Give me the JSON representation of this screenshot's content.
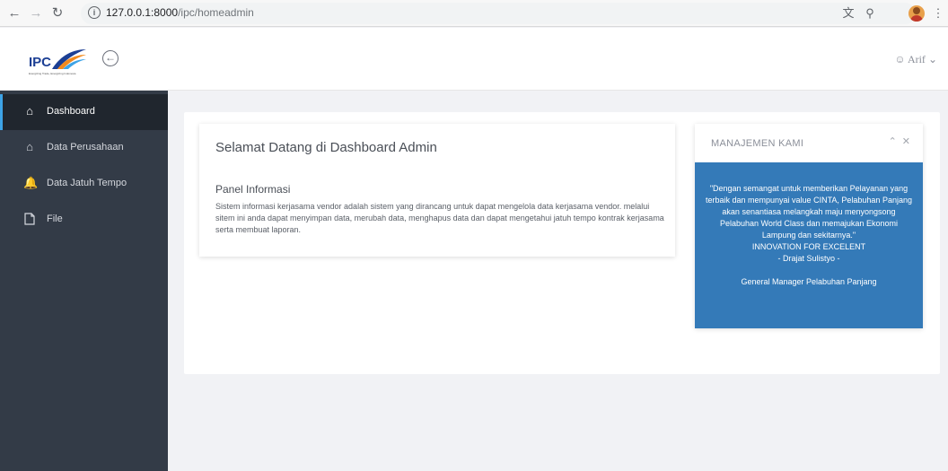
{
  "browser": {
    "back_icon": "arrow-left-icon",
    "forward_icon": "arrow-right-icon",
    "reload_icon": "reload-icon",
    "url_host": "127.0.0.1:8000",
    "url_path": "/ipc/homeadmin"
  },
  "header": {
    "logo_text": "IPC",
    "logo_tagline": "Energizing Trade, Energizing Indonesia",
    "user_name": "Arif"
  },
  "sidebar": {
    "items": [
      {
        "label": "Dashboard",
        "icon": "home-icon",
        "active": true
      },
      {
        "label": "Data Perusahaan",
        "icon": "home-icon",
        "active": false
      },
      {
        "label": "Data Jatuh Tempo",
        "icon": "bell-icon",
        "active": false
      },
      {
        "label": "File",
        "icon": "file-icon",
        "active": false
      }
    ]
  },
  "main": {
    "welcome_title": "Selamat Datang di Dashboard Admin",
    "panel_title": "Panel Informasi",
    "panel_text": "Sistem informasi kerjasama vendor adalah sistem yang dirancang untuk dapat mengelola data kerjasama vendor. melalui sitem ini anda dapat menyimpan data, merubah data, menghapus data dan dapat mengetahui jatuh tempo kontrak kerjasama serta membuat laporan."
  },
  "management": {
    "title": "MANAJEMEN KAMI",
    "quote_lines": [
      "\"Dengan semangat untuk memberikan Pelayanan yang",
      "terbaik dan mempunyai value CINTA, Pelabuhan Panjang",
      "akan senantiasa melangkah maju menyongsong",
      "Pelabuhan World Class dan memajukan Ekonomi",
      "Lampung dan sekitarnya.\""
    ],
    "motto": "INNOVATION FOR EXCELENT",
    "author": "- Drajat Sulistyo -",
    "role": "General Manager Pelabuhan Panjang"
  },
  "colors": {
    "sidebar_bg": "#333b47",
    "sidebar_active_bg": "#20262e",
    "sidebar_accent": "#3da3e6",
    "management_bg": "#347ab8",
    "logo_blue": "#1c3f94",
    "logo_orange": "#f28a1e"
  }
}
